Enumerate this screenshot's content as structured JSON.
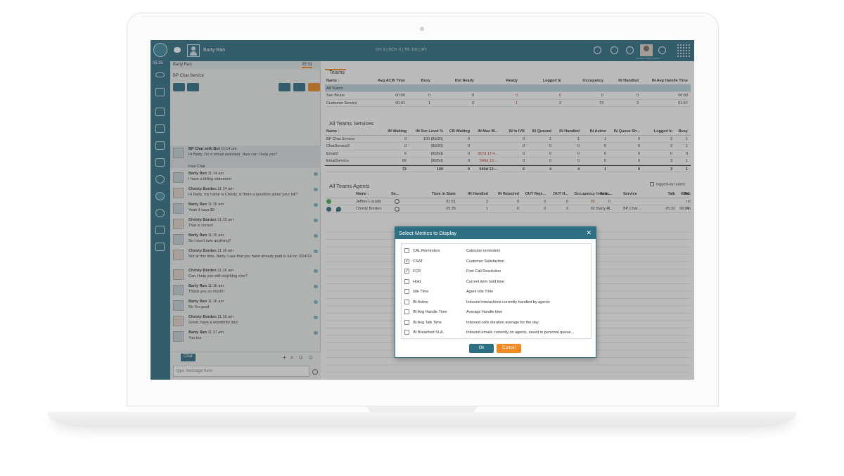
{
  "topbar": {
    "user_name": "Barty Ran",
    "stats": "CH: 0  |  DCH: 0  |  TR: 100  |  WT:",
    "rank_caption": "Rovakos to Bright Nature"
  },
  "sidebar": {
    "time": "05:35"
  },
  "chat": {
    "header_name": "Barty Ran",
    "header_timer": "05:31",
    "service": "BP Chat Service",
    "five_chat": "Five Chat",
    "messages": [
      {
        "from": "BP Chat with Bot",
        "time": "11:14 am",
        "text": "Hi Barty, I'm a virtual assistant. How can I help you?"
      },
      {
        "from": "Barty Ran",
        "time": "11:14 am",
        "text": "I have a billing statement"
      },
      {
        "from": "Christy Borden",
        "time": "11:14 am",
        "text": "Hi Barty, my name is Christy, is there a question about your bill?"
      },
      {
        "from": "Barty Ran",
        "time": "11:15 am",
        "text": "Yeah it says $0"
      },
      {
        "from": "Christy Borden",
        "time": "11:15 am",
        "text": "That is correct"
      },
      {
        "from": "Barty Ran",
        "time": "11:15 am",
        "text": "So I don't owe anything?"
      },
      {
        "from": "Christy Borden",
        "time": "11:16 am",
        "text": "Not at this time, Barty. I see that you have already paid in full on 3/24/19"
      },
      {
        "from": "Barty Ran",
        "time": "11:16 am",
        "text": "Thank you so much!!"
      },
      {
        "from": "Christy Borden",
        "time": "11:16 am",
        "text": "Can I help you with anything else?"
      },
      {
        "from": "Barty Ran",
        "time": "11:16 am",
        "text": "Thank you so much!!"
      },
      {
        "from": "Barty Ran",
        "time": "11:16 am",
        "text": "No I'm good"
      },
      {
        "from": "Christy Borden",
        "time": "11:16 am",
        "text": "Great, have a wonderful day!"
      },
      {
        "from": "Barty Ran",
        "time": "11:17 am",
        "text": "You too"
      }
    ],
    "tab_label": "Chat",
    "input_placeholder": "type message here"
  },
  "teams": {
    "title": "Teams",
    "headers": [
      "Name ↓",
      "Avg ACW Time",
      "Busy",
      "Not Ready",
      "Ready",
      "Logged In",
      "Occupancy",
      "IN Handled",
      "IN Avg Handle Time"
    ],
    "selected": "All Teams",
    "rows": [
      [
        "San Bruno",
        "00:00",
        "0",
        "0",
        "0",
        "0",
        "0",
        "0",
        "00:00"
      ],
      [
        "Customer Service",
        "00:01",
        "1",
        "0",
        "1",
        "2",
        "73",
        "3",
        "01:57"
      ]
    ]
  },
  "services": {
    "title": "All Teams Services",
    "headers": [
      "Name ↑",
      "IN Waiting",
      "IN Svc Level %",
      "CB Waiting",
      "IN Max W...",
      "IN In IVR",
      "IN Queued",
      "IN Handled",
      "IN Active",
      "IN Queue Sh...",
      "Logged In",
      "Busy"
    ],
    "rows": [
      [
        "BP Chat Service",
        "0",
        "100 (80/20)",
        "0",
        "",
        "0",
        "1",
        "1",
        "1",
        "0",
        "2",
        "1"
      ],
      [
        "ChatService2",
        "0",
        "(80/20)",
        "0",
        "",
        "0",
        "0",
        "0",
        "0",
        "0",
        "2",
        "1"
      ],
      [
        "Email2",
        "6",
        "(80/5d)",
        "0",
        "357d 17:4...",
        "0",
        "0",
        "0",
        "0",
        "0",
        "0",
        "0"
      ],
      [
        "EmailService",
        "66",
        "(80/5d)",
        "0",
        "540d 13:...",
        "0",
        "0",
        "0",
        "0",
        "0",
        "3",
        "1"
      ]
    ],
    "totals": [
      "",
      "72",
      "100",
      "0",
      "540d 13:...",
      "0",
      "4",
      "4",
      "1",
      "0",
      "3",
      "1"
    ]
  },
  "agents": {
    "title": "All Teams Agents",
    "logged_out_label": "logged-out users",
    "headers": [
      "Name ↓",
      "Se...",
      "Time in State",
      "IN Handled",
      "IN Rejected",
      "OUT Reje...",
      "OUT H...",
      "Occupancy",
      "Acti...",
      "Interac...",
      "Service",
      "Talk",
      "Hold",
      "Rec"
    ],
    "rows": [
      [
        "Jeffery Lozada",
        "",
        "01:51",
        "2",
        "0",
        "0",
        "0",
        "65",
        "0",
        "",
        "",
        "",
        "",
        "no"
      ],
      [
        "Christy Borden",
        "",
        "05:35",
        "1",
        "0",
        "0",
        "0",
        "82",
        "1",
        "Barty R...",
        "BP Chat ...",
        "05:32",
        "00:00",
        "no"
      ]
    ]
  },
  "dialog": {
    "title": "Select Metrics to Display",
    "metrics": [
      {
        "name": "CAL Reminders",
        "desc": "Calendar reminders",
        "checked": false
      },
      {
        "name": "CSAT",
        "desc": "Customer Satisfaction",
        "checked": true
      },
      {
        "name": "FCR",
        "desc": "First Call Resolution",
        "checked": true
      },
      {
        "name": "Hold",
        "desc": "Current item hold time",
        "checked": false
      },
      {
        "name": "Idle Time",
        "desc": "Agent Idle Time",
        "checked": false
      },
      {
        "name": "IN Active",
        "desc": "Inbound interactions currently handled by agents",
        "checked": false
      },
      {
        "name": "IN Avg Handle Time",
        "desc": "Average Handle time",
        "checked": false
      },
      {
        "name": "IN Avg Talk Time",
        "desc": "Inbound calls duration average for the day",
        "checked": false
      },
      {
        "name": "IN Breached SLA",
        "desc": "Inbound emails currently on agents, saved in personal queue...",
        "checked": false
      }
    ],
    "ok_label": "Ok",
    "cancel_label": "Cancel"
  },
  "colors": {
    "primary": "#2e6f84",
    "accent": "#f08a24",
    "alert": "#c0392b"
  }
}
